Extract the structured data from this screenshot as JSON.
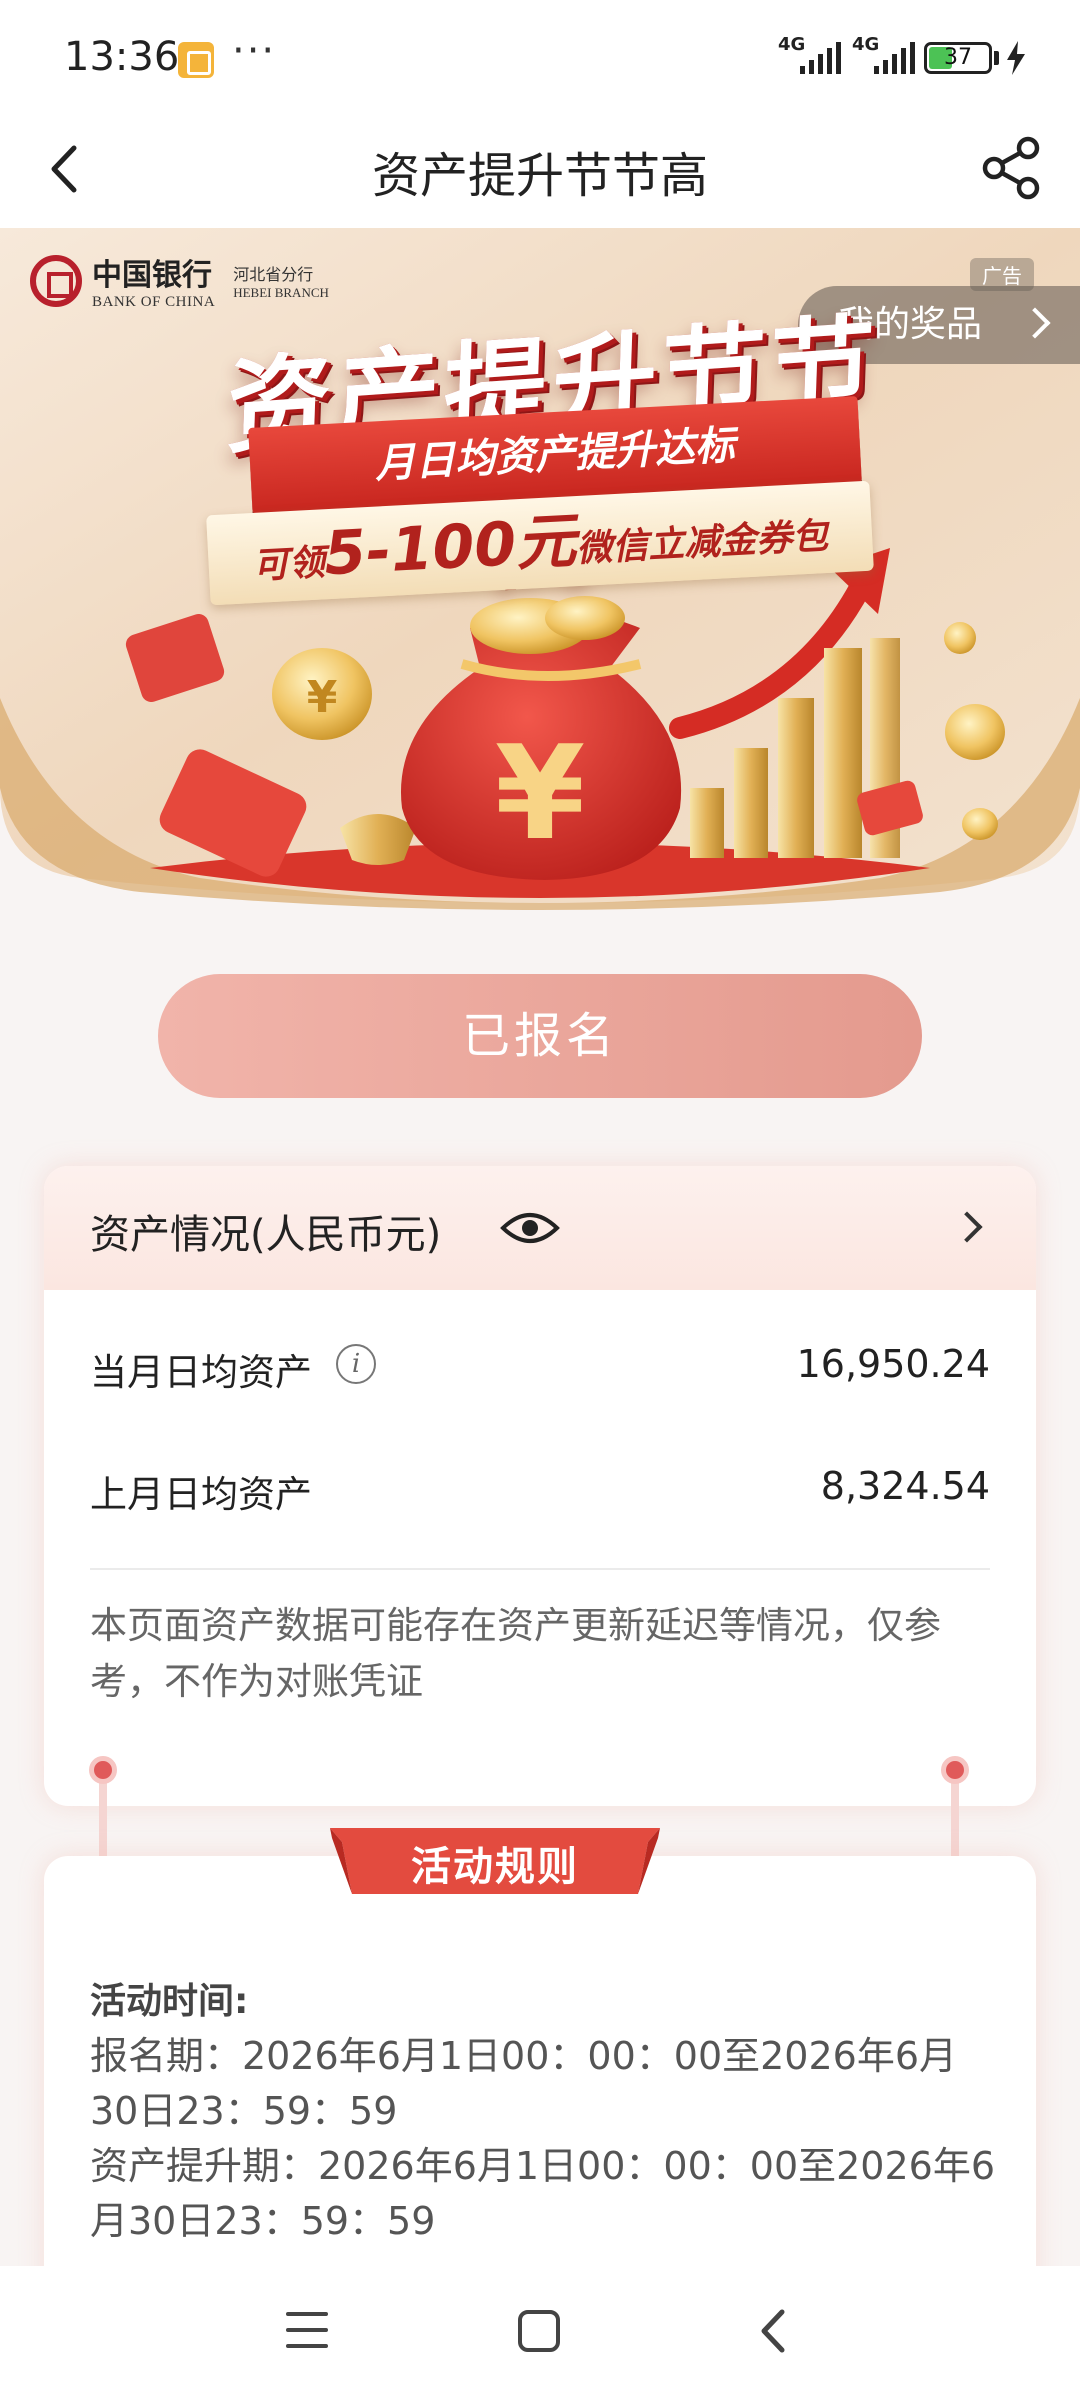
{
  "status_bar": {
    "time": "13:36",
    "dots": "···",
    "network1": "4G",
    "network2": "4G",
    "battery": "37",
    "battery_level": 0.37,
    "icons": [
      "notification-icon",
      "signal-icon",
      "battery-icon",
      "charging-icon"
    ]
  },
  "header": {
    "title": "资产提升节节高",
    "back_icon": "chevron-left-icon",
    "share_icon": "share-icon"
  },
  "banner": {
    "bank_name_cn": "中国银行",
    "bank_name_en": "BANK OF CHINA",
    "branch_cn": "河北省分行",
    "branch_en": "HEBEI BRANCH",
    "ad_label": "广告",
    "prize_label": "我的奖品",
    "headline": "资产提升节节高",
    "subline": "月日均资产提升达标",
    "offer_prefix": "可领",
    "offer_amount": "5-100元",
    "offer_suffix": "微信立减金券包"
  },
  "signup": {
    "label": "已报名",
    "state": "disabled"
  },
  "assets": {
    "title": "资产情况(人民币元)",
    "rows": [
      {
        "label": "当月日均资产",
        "value": "16,950.24"
      },
      {
        "label": "上月日均资产",
        "value": "8,324.54"
      }
    ],
    "note": "本页面资产数据可能存在资产更新延迟等情况，仅参考，不作为对账凭证"
  },
  "rules": {
    "tab_label": "活动规则",
    "heading": "活动时间:",
    "lines": [
      "报名期：2026年6月1日00：00：00至2026年6月30日23：59：59",
      "资产提升期：2026年6月1日00：00：00至2026年6月30日23：59：59"
    ]
  },
  "nav": {
    "icons": [
      "menu-icon",
      "home-icon",
      "back-icon"
    ]
  },
  "colors": {
    "accent_red": "#c8261f",
    "button_pink": "#e9a79c",
    "card_head": "#fbe6e0",
    "battery_green": "#4cc255"
  }
}
